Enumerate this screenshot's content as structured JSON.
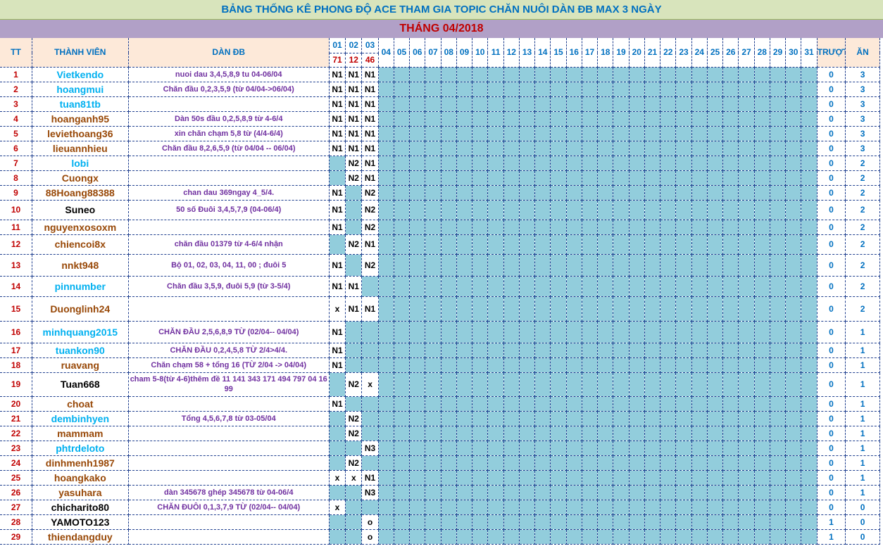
{
  "title": "BẢNG THỐNG KÊ PHONG ĐỘ ACE THAM GIA TOPIC CHĂN NUÔI DÀN ĐB MAX 3 NGÀY",
  "month": "THÁNG 04/2018",
  "headers": {
    "tt": "TT",
    "member": "THÀNH VIÊN",
    "dan": "DÀN ĐB",
    "truot": "TRƯỢT",
    "an": "ĂN"
  },
  "days": [
    "01",
    "02",
    "03",
    "04",
    "05",
    "06",
    "07",
    "08",
    "09",
    "10",
    "11",
    "12",
    "13",
    "14",
    "15",
    "16",
    "17",
    "18",
    "19",
    "20",
    "21",
    "22",
    "23",
    "24",
    "25",
    "26",
    "27",
    "28",
    "29",
    "30",
    "31"
  ],
  "results": [
    "71",
    "12",
    "46"
  ],
  "colors": {
    "title_bg": "#d8e4bc",
    "month_bg": "#b1a0c7",
    "grid_cell": "#92cddc",
    "header_bg": "#fde9d9",
    "tt_red": "#c00000",
    "blue": "#0070c0"
  },
  "rows": [
    {
      "tt": "1",
      "name": "Vietkendo",
      "color": "blue",
      "dan": "nuoi dau 3,4,5,8,9 tu 04-06/04",
      "dan_color": "purple",
      "d": [
        "N1",
        "N1",
        "N1"
      ],
      "truot": "0",
      "an": "3"
    },
    {
      "tt": "2",
      "name": "hoangmui",
      "color": "blue",
      "dan": "Chăn đầu 0,2,3,5,9 (từ 04/04->06/04)",
      "dan_color": "purple",
      "d": [
        "N1",
        "N1",
        "N1"
      ],
      "truot": "0",
      "an": "3"
    },
    {
      "tt": "3",
      "name": "tuan81tb",
      "color": "blue",
      "dan": "",
      "dan_color": "purple",
      "d": [
        "N1",
        "N1",
        "N1"
      ],
      "truot": "0",
      "an": "3"
    },
    {
      "tt": "4",
      "name": "hoanganh95",
      "color": "brown",
      "dan": "Dàn 50s đầu 0,2,5,8,9 từ 4-6/4",
      "dan_color": "purple",
      "d": [
        "N1",
        "N1",
        "N1"
      ],
      "truot": "0",
      "an": "3"
    },
    {
      "tt": "5",
      "name": "leviethoang36",
      "color": "brown",
      "dan": "xin chăn chạm 5,8 từ (4/4-6/4)",
      "dan_color": "purple",
      "d": [
        "N1",
        "N1",
        "N1"
      ],
      "truot": "0",
      "an": "3"
    },
    {
      "tt": "6",
      "name": "lieuannhieu",
      "color": "brown",
      "dan": "Chăn đầu 8,2,6,5,9 (từ 04/04 -- 06/04)",
      "dan_color": "purple",
      "d": [
        "N1",
        "N1",
        "N1"
      ],
      "truot": "0",
      "an": "3"
    },
    {
      "tt": "7",
      "name": "lobi",
      "color": "blue",
      "dan": "",
      "dan_color": "purple",
      "d": [
        "",
        "N2",
        "N1"
      ],
      "truot": "0",
      "an": "2"
    },
    {
      "tt": "8",
      "name": "Cuongx",
      "color": "brown",
      "dan": "",
      "dan_color": "purple",
      "d": [
        "",
        "N2",
        "N1"
      ],
      "truot": "0",
      "an": "2"
    },
    {
      "tt": "9",
      "name": "88Hoang88388",
      "color": "brown",
      "dan": "chan dau 369ngay 4_5/4.",
      "dan_color": "purple",
      "d": [
        "N1",
        "",
        "N2"
      ],
      "truot": "0",
      "an": "2"
    },
    {
      "tt": "10",
      "name": "Suneo",
      "color": "black",
      "dan": "50 số Đuôi 3,4,5,7,9  (04-06/4)",
      "dan_color": "purple",
      "d": [
        "N1",
        "",
        "N2"
      ],
      "truot": "0",
      "an": "2"
    },
    {
      "tt": "11",
      "name": "nguyenxosoxm",
      "color": "brown",
      "dan": "",
      "dan_color": "purple",
      "d": [
        "N1",
        "",
        "N2"
      ],
      "truot": "0",
      "an": "2"
    },
    {
      "tt": "12",
      "name": "chiencoi8x",
      "color": "brown",
      "dan": "chăn đầu 01379 từ 4-6/4 nhận",
      "dan_color": "purple",
      "d": [
        "",
        "N2",
        "N1"
      ],
      "truot": "0",
      "an": "2"
    },
    {
      "tt": "13",
      "name": "nnkt948",
      "color": "brown",
      "dan": "Bộ 01, 02, 03, 04, 11, 00 ; đuôi 5",
      "dan_color": "purple",
      "d": [
        "N1",
        "",
        "N2"
      ],
      "truot": "0",
      "an": "2"
    },
    {
      "tt": "14",
      "name": "pinnumber",
      "color": "blue",
      "dan": "Chăn đầu 3,5,9, đuôi 5,9 (từ 3-5/4)",
      "dan_color": "purple",
      "d": [
        "N1",
        "N1",
        ""
      ],
      "truot": "0",
      "an": "2"
    },
    {
      "tt": "15",
      "name": "Duonglinh24",
      "color": "brown",
      "dan": "",
      "dan_color": "purple",
      "d": [
        "x",
        "N1",
        "N1"
      ],
      "truot": "0",
      "an": "2"
    },
    {
      "tt": "16",
      "name": "minhquang2015",
      "color": "blue",
      "dan": "CHĂN ĐẦU 2,5,6,8,9 TỪ (02/04-- 04/04)",
      "dan_color": "purple",
      "d": [
        "N1",
        "",
        ""
      ],
      "truot": "0",
      "an": "1"
    },
    {
      "tt": "17",
      "name": "tuankon90",
      "color": "blue",
      "dan": "CHĂN ĐẦU 0,2,4,5,8 TỪ 2/4>4/4.",
      "dan_color": "purple",
      "d": [
        "N1",
        "",
        ""
      ],
      "truot": "0",
      "an": "1"
    },
    {
      "tt": "18",
      "name": "ruavang",
      "color": "brown",
      "dan": "Chăn chạm 58 + tổng 16 (TỪ 2/04 -> 04/04)",
      "dan_color": "purple",
      "d": [
        "N1",
        "",
        ""
      ],
      "truot": "0",
      "an": "1"
    },
    {
      "tt": "19",
      "name": "Tuan668",
      "color": "black",
      "dan": "cham 5-8(từ 4-6)thêm đề 11 141 343 171 494 797 04 16 99",
      "dan_color": "purple",
      "d": [
        "",
        "N2",
        "x"
      ],
      "truot": "0",
      "an": "1"
    },
    {
      "tt": "20",
      "name": "choat",
      "color": "brown",
      "dan": "",
      "dan_color": "purple",
      "d": [
        "N1",
        "",
        ""
      ],
      "truot": "0",
      "an": "1"
    },
    {
      "tt": "21",
      "name": "dembinhyen",
      "color": "blue",
      "dan": "Tổng 4,5,6,7,8 từ 03-05/04",
      "dan_color": "purple",
      "d": [
        "",
        "N2",
        ""
      ],
      "truot": "0",
      "an": "1"
    },
    {
      "tt": "22",
      "name": "mammam",
      "color": "brown",
      "dan": "",
      "dan_color": "purple",
      "d": [
        "",
        "N2",
        ""
      ],
      "truot": "0",
      "an": "1"
    },
    {
      "tt": "23",
      "name": "phtrdeloto",
      "color": "blue",
      "dan": "",
      "dan_color": "purple",
      "d": [
        "",
        "",
        "N3"
      ],
      "truot": "0",
      "an": "1"
    },
    {
      "tt": "24",
      "name": "dinhmenh1987",
      "color": "brown",
      "dan": "",
      "dan_color": "purple",
      "d": [
        "",
        "N2",
        ""
      ],
      "truot": "0",
      "an": "1"
    },
    {
      "tt": "25",
      "name": "hoangkako",
      "color": "brown",
      "dan": "",
      "dan_color": "purple",
      "d": [
        "x",
        "x",
        "N1"
      ],
      "truot": "0",
      "an": "1"
    },
    {
      "tt": "26",
      "name": "yasuhara",
      "color": "brown",
      "dan": "dàn 345678 ghép 345678 từ 04-06/4",
      "dan_color": "purple",
      "d": [
        "",
        "",
        "N3"
      ],
      "truot": "0",
      "an": "1"
    },
    {
      "tt": "27",
      "name": "chicharito80",
      "color": "black",
      "dan": "CHĂN ĐUÔI 0,1,3,7,9 TỪ (02/04-- 04/04)",
      "dan_color": "purple",
      "d": [
        "x",
        "",
        ""
      ],
      "truot": "0",
      "an": "0"
    },
    {
      "tt": "28",
      "name": "YAMOTO123",
      "color": "black",
      "dan": "",
      "dan_color": "purple",
      "d": [
        "",
        "",
        "o"
      ],
      "truot": "1",
      "an": "0"
    },
    {
      "tt": "29",
      "name": "thiendangduy",
      "color": "brown",
      "dan": "",
      "dan_color": "purple",
      "d": [
        "",
        "",
        "o"
      ],
      "truot": "1",
      "an": "0"
    }
  ]
}
